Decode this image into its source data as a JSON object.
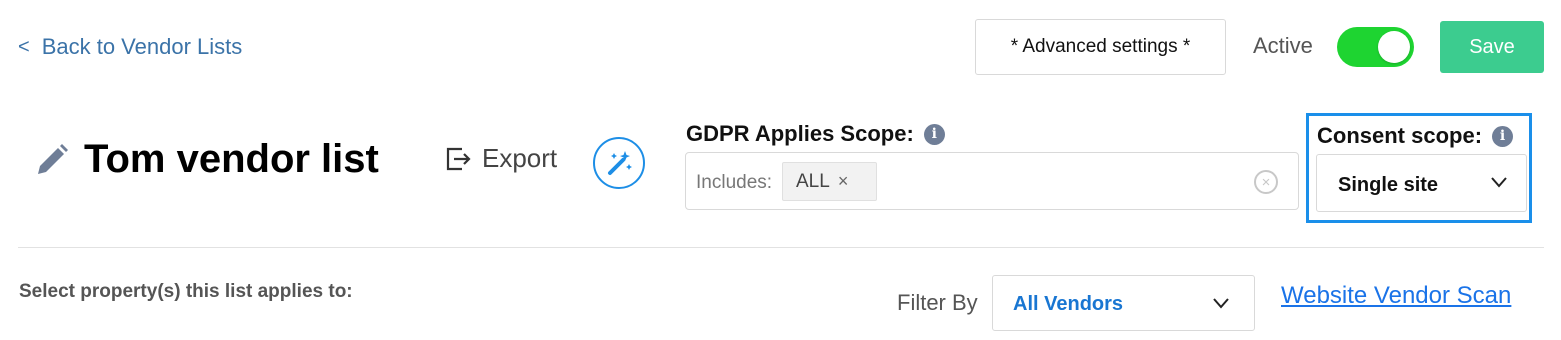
{
  "header": {
    "back_chevron": "<",
    "back_label": "Back to Vendor Lists",
    "advanced_settings_label": "* Advanced settings *",
    "active_label": "Active",
    "active_state": true,
    "save_label": "Save"
  },
  "vendor_list": {
    "title": "Tom vendor list",
    "export_label": "Export"
  },
  "gdpr_scope": {
    "label": "GDPR Applies Scope:",
    "info_icon": "i",
    "includes_label": "Includes:",
    "tags": [
      {
        "label": "ALL",
        "remove_icon": "×"
      }
    ]
  },
  "consent_scope": {
    "label": "Consent scope:",
    "info_icon": "i",
    "selected": "Single site"
  },
  "properties": {
    "label": "Select property(s) this list applies to:"
  },
  "filter": {
    "label": "Filter By",
    "selected": "All Vendors"
  },
  "scan_link": {
    "label": "Website Vendor Scan"
  },
  "colors": {
    "link": "#3b73a8",
    "toggle_on": "#1ed431",
    "save_button": "#3ccc8f",
    "consent_highlight": "#1a8fea",
    "filter_value": "#1976d2",
    "scan_link": "#1a73e8"
  },
  "icons": {
    "pencil": "pencil-icon",
    "export": "export-icon",
    "wand": "magic-wand-icon",
    "clear": "clear-circle-icon",
    "chevron": "chevron-down-icon"
  }
}
